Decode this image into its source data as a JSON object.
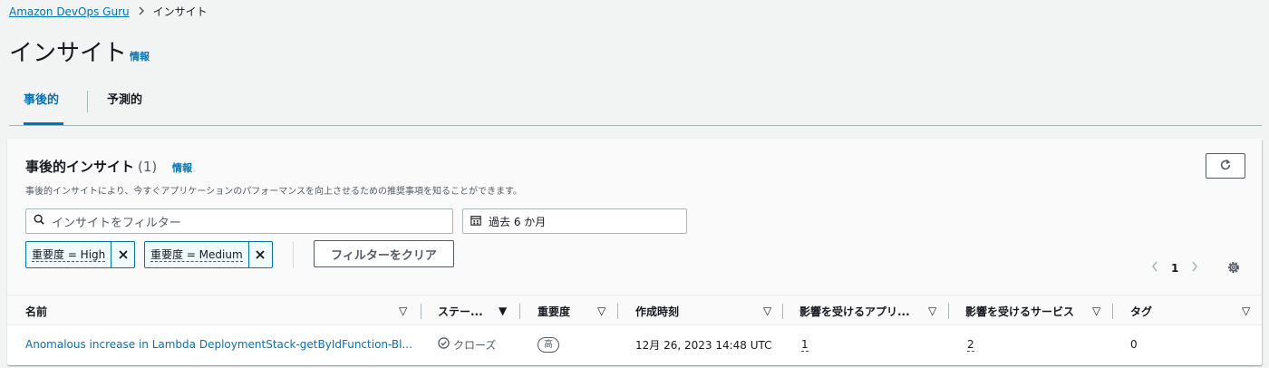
{
  "breadcrumb": {
    "root": "Amazon DevOps Guru",
    "current": "インサイト"
  },
  "page": {
    "title": "インサイト",
    "info": "情報"
  },
  "tabs": [
    {
      "label": "事後的",
      "active": true
    },
    {
      "label": "予測的",
      "active": false
    }
  ],
  "panel": {
    "title": "事後的インサイト",
    "count": "(1)",
    "info": "情報",
    "description": "事後的インサイトにより、今すぐアプリケーションのパフォーマンスを向上させるための推奨事項を知ることができます。"
  },
  "filters": {
    "search_placeholder": "インサイトをフィルター",
    "date_range": "過去 6 か月",
    "tokens": [
      {
        "label": "重要度 = High"
      },
      {
        "label": "重要度 = Medium"
      }
    ],
    "clear_label": "フィルターをクリア"
  },
  "pagination": {
    "current_page": "1"
  },
  "table": {
    "columns": [
      {
        "label": "名前"
      },
      {
        "label": "ステー..."
      },
      {
        "label": "重要度"
      },
      {
        "label": "作成時刻"
      },
      {
        "label": "影響を受けるアプリ..."
      },
      {
        "label": "影響を受けるサービス"
      },
      {
        "label": "タグ"
      }
    ],
    "rows": [
      {
        "name": "Anomalous increase in Lambda DeploymentStack-getByIdFunction-Bl...",
        "status": "クローズ",
        "severity": "高",
        "created": "12月 26, 2023 14:48 UTC",
        "affected_apps": "1",
        "affected_services": "2",
        "tags": "0"
      }
    ]
  },
  "colors": {
    "link": "#0073bb",
    "text": "#16191f",
    "muted": "#545b64",
    "background": "#f2f3f3"
  },
  "icons": [
    "refresh-icon",
    "search-icon",
    "calendar-icon",
    "close-icon",
    "chevron-left-icon",
    "chevron-right-icon",
    "gear-icon",
    "sort-down-icon",
    "check-circle-icon"
  ]
}
